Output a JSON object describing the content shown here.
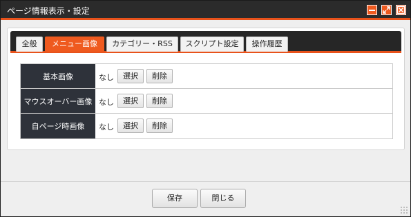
{
  "window": {
    "title": "ページ情報表示・設定",
    "accent_color": "#ef5a1f",
    "titlebar_color": "#2b2b2b",
    "controls": [
      "minimize-icon",
      "maximize-icon",
      "close-icon"
    ]
  },
  "tabs": [
    {
      "label": "全般",
      "active": false
    },
    {
      "label": "メニュー画像",
      "active": true
    },
    {
      "label": "カテゴリー・RSS",
      "active": false
    },
    {
      "label": "スクリプト設定",
      "active": false
    },
    {
      "label": "操作履歴",
      "active": false
    }
  ],
  "image_rows": [
    {
      "label": "基本画像",
      "value": "なし",
      "select": "選択",
      "delete": "削除"
    },
    {
      "label": "マウスオーバー画像",
      "value": "なし",
      "select": "選択",
      "delete": "削除"
    },
    {
      "label": "自ページ時画像",
      "value": "なし",
      "select": "選択",
      "delete": "削除"
    }
  ],
  "footer": {
    "save_label": "保存",
    "close_label": "閉じる"
  }
}
